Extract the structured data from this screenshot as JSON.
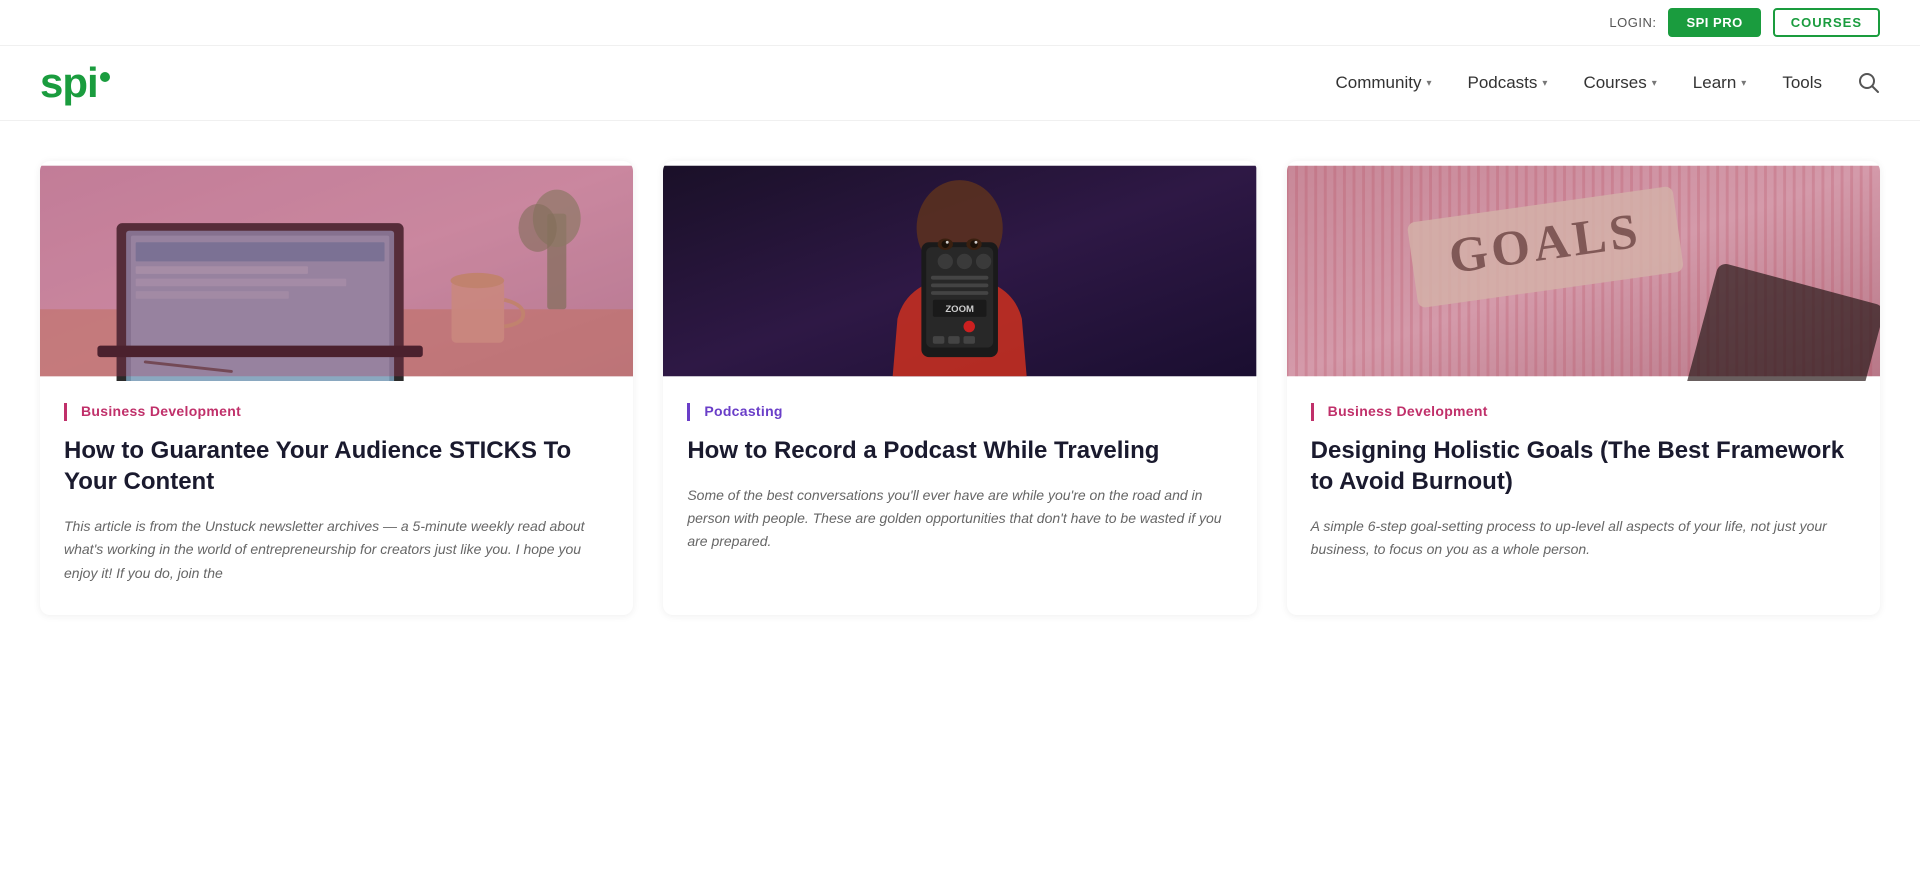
{
  "header": {
    "login_label": "LOGIN:",
    "spi_pro_label": "SPI PRO",
    "courses_btn_label": "COURSES"
  },
  "nav": {
    "logo": "spi",
    "items": [
      {
        "label": "Community",
        "has_dropdown": true
      },
      {
        "label": "Podcasts",
        "has_dropdown": true
      },
      {
        "label": "Courses",
        "has_dropdown": true
      },
      {
        "label": "Learn",
        "has_dropdown": true
      },
      {
        "label": "Tools",
        "has_dropdown": false
      }
    ]
  },
  "cards": [
    {
      "category": "Business Development",
      "title": "How to Guarantee Your Audience STICKS To Your Content",
      "excerpt": "This article is from the Unstuck newsletter archives — a 5-minute weekly read about what's working in the world of entrepreneurship for creators just like you. I hope you enjoy it! If you do, join the",
      "image_type": "laptop"
    },
    {
      "category": "Podcasting",
      "title": "How to Record a Podcast While Traveling",
      "excerpt": "Some of the best conversations you'll ever have are while you're on the road and in person with people. These are golden opportunities that don't have to be wasted if you are prepared.",
      "image_type": "recorder"
    },
    {
      "category": "Business Development",
      "title": "Designing Holistic Goals (The Best Framework to Avoid Burnout)",
      "excerpt": "A simple 6-step goal-setting process to up-level all aspects of your life, not just your business, to focus on you as a whole person.",
      "image_type": "goals"
    }
  ],
  "colors": {
    "brand_green": "#1a9c3e",
    "accent_pink": "#c0306a",
    "accent_purple": "#6a3ec8"
  }
}
